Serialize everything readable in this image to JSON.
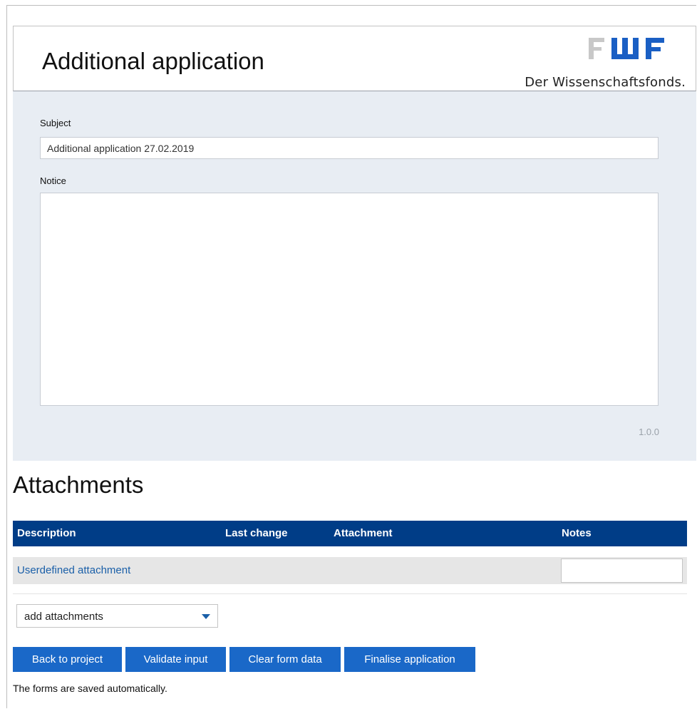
{
  "header": {
    "title": "Additional application",
    "logo_text": "FWF",
    "logo_subtitle": "Der Wissenschaftsfonds.",
    "logo_colors": {
      "f_light": "#c8c8c8",
      "w_blue": "#1a5fc4",
      "f_blue": "#1a5fc4"
    }
  },
  "form": {
    "subject_label": "Subject",
    "subject_value": "Additional application 27.02.2019",
    "notice_label": "Notice",
    "notice_value": "",
    "version": "1.0.0"
  },
  "attachments": {
    "title": "Attachments",
    "columns": [
      "Description",
      "Last change",
      "Attachment",
      "Notes"
    ],
    "rows": [
      {
        "description": "Userdefined attachment",
        "last_change": "",
        "attachment": "",
        "notes": ""
      }
    ],
    "add_select": {
      "selected": "add attachments",
      "icon": "chevron-down-icon"
    }
  },
  "buttons": {
    "back": "Back to project",
    "validate": "Validate input",
    "clear": "Clear form data",
    "finalise": "Finalise application"
  },
  "footer_note": "The forms are saved automatically.",
  "colors": {
    "panel_bg": "#e8edf3",
    "table_header_bg": "#003d87",
    "button_bg": "#1a68c8",
    "link": "#1a5fa8"
  }
}
